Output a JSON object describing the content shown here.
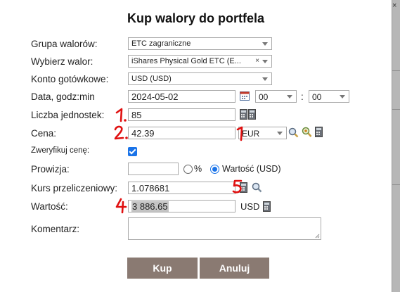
{
  "dialog": {
    "title": "Kup walory do portfela"
  },
  "form": {
    "asset_group": {
      "label": "Grupa walorów:",
      "value": "ETC zagraniczne"
    },
    "asset": {
      "label": "Wybierz walor:",
      "value": "iShares Physical Gold ETC (E..."
    },
    "cash_account": {
      "label": "Konto gotówkowe:",
      "value": "USD (USD)"
    },
    "datetime": {
      "label": "Data, godz:min",
      "date": "2024-05-02",
      "hour": "00",
      "separator": ":",
      "minute": "00"
    },
    "units": {
      "label": "Liczba jednostek:",
      "value": "85"
    },
    "price": {
      "label": "Cena:",
      "value": "42.39",
      "currency": "EUR"
    },
    "verify_price": {
      "label": "Zweryfikuj cenę:",
      "checked": true
    },
    "commission": {
      "label": "Prowizja:",
      "value": "",
      "percent_label": "%",
      "value_option_label": "Wartość (USD)"
    },
    "fx_rate": {
      "label": "Kurs przeliczeniowy:",
      "value": "1.078681"
    },
    "total": {
      "label": "Wartość:",
      "value": "3 886.65",
      "currency": "USD"
    },
    "comment": {
      "label": "Komentarz:",
      "value": ""
    }
  },
  "buttons": {
    "buy": "Kup",
    "cancel": "Anuluj"
  },
  "annotations": [
    "1",
    "2",
    "1",
    "5",
    "4"
  ],
  "colors": {
    "annotation": "#e01010",
    "button": "#8a7a72",
    "check": "#1a73e8"
  }
}
